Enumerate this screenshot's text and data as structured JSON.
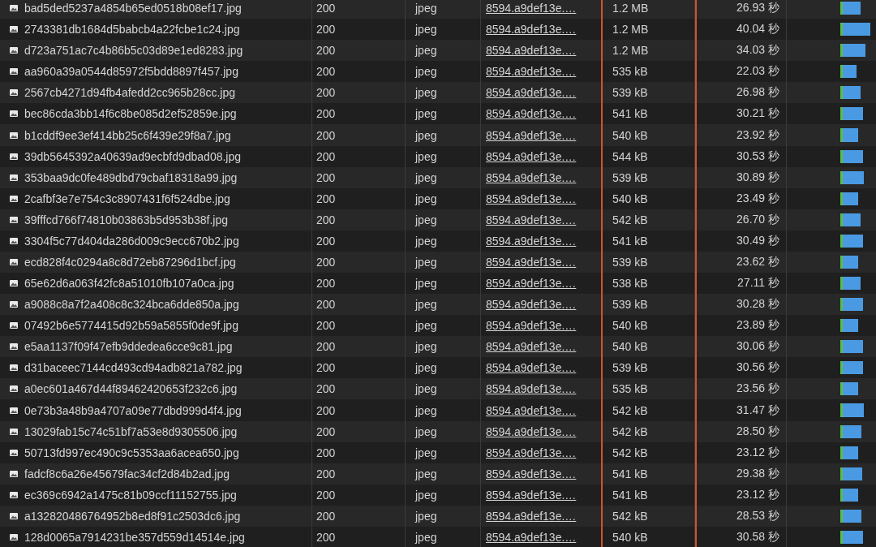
{
  "requests": [
    {
      "name": "bad5ded5237a4854b65ed0518b08ef17.jpg",
      "status": "200",
      "type": "jpeg",
      "initiator": "8594.a9def13e.…",
      "size": "1.2 MB",
      "time": "26.93 秒"
    },
    {
      "name": "2743381db1684d5babcb4a22fcbe1c24.jpg",
      "status": "200",
      "type": "jpeg",
      "initiator": "8594.a9def13e.…",
      "size": "1.2 MB",
      "time": "40.04 秒"
    },
    {
      "name": "d723a751ac7c4b86b5c03d89e1ed8283.jpg",
      "status": "200",
      "type": "jpeg",
      "initiator": "8594.a9def13e.…",
      "size": "1.2 MB",
      "time": "34.03 秒"
    },
    {
      "name": "aa960a39a0544d85972f5bdd8897f457.jpg",
      "status": "200",
      "type": "jpeg",
      "initiator": "8594.a9def13e.…",
      "size": "535 kB",
      "time": "22.03 秒"
    },
    {
      "name": "2567cb4271d94fb4afedd2cc965b28cc.jpg",
      "status": "200",
      "type": "jpeg",
      "initiator": "8594.a9def13e.…",
      "size": "539 kB",
      "time": "26.98 秒"
    },
    {
      "name": "bec86cda3bb14f6c8be085d2ef52859e.jpg",
      "status": "200",
      "type": "jpeg",
      "initiator": "8594.a9def13e.…",
      "size": "541 kB",
      "time": "30.21 秒"
    },
    {
      "name": "b1cddf9ee3ef414bb25c6f439e29f8a7.jpg",
      "status": "200",
      "type": "jpeg",
      "initiator": "8594.a9def13e.…",
      "size": "540 kB",
      "time": "23.92 秒"
    },
    {
      "name": "39db5645392a40639ad9ecbfd9dbad08.jpg",
      "status": "200",
      "type": "jpeg",
      "initiator": "8594.a9def13e.…",
      "size": "544 kB",
      "time": "30.53 秒"
    },
    {
      "name": "353baa9dc0fe489dbd79cbaf18318a99.jpg",
      "status": "200",
      "type": "jpeg",
      "initiator": "8594.a9def13e.…",
      "size": "539 kB",
      "time": "30.89 秒"
    },
    {
      "name": "2cafbf3e7e754c3c8907431f6f524dbe.jpg",
      "status": "200",
      "type": "jpeg",
      "initiator": "8594.a9def13e.…",
      "size": "540 kB",
      "time": "23.49 秒"
    },
    {
      "name": "39fffcd766f74810b03863b5d953b38f.jpg",
      "status": "200",
      "type": "jpeg",
      "initiator": "8594.a9def13e.…",
      "size": "542 kB",
      "time": "26.70 秒"
    },
    {
      "name": "3304f5c77d404da286d009c9ecc670b2.jpg",
      "status": "200",
      "type": "jpeg",
      "initiator": "8594.a9def13e.…",
      "size": "541 kB",
      "time": "30.49 秒"
    },
    {
      "name": "ecd828f4c0294a8c8d72eb87296d1bcf.jpg",
      "status": "200",
      "type": "jpeg",
      "initiator": "8594.a9def13e.…",
      "size": "539 kB",
      "time": "23.62 秒"
    },
    {
      "name": "65e62d6a063f42fc8a51010fb107a0ca.jpg",
      "status": "200",
      "type": "jpeg",
      "initiator": "8594.a9def13e.…",
      "size": "538 kB",
      "time": "27.11 秒"
    },
    {
      "name": "a9088c8a7f2a408c8c324bca6dde850a.jpg",
      "status": "200",
      "type": "jpeg",
      "initiator": "8594.a9def13e.…",
      "size": "539 kB",
      "time": "30.28 秒"
    },
    {
      "name": "07492b6e5774415d92b59a5855f0de9f.jpg",
      "status": "200",
      "type": "jpeg",
      "initiator": "8594.a9def13e.…",
      "size": "540 kB",
      "time": "23.89 秒"
    },
    {
      "name": "e5aa1137f09f47efb9ddedea6cce9c81.jpg",
      "status": "200",
      "type": "jpeg",
      "initiator": "8594.a9def13e.…",
      "size": "540 kB",
      "time": "30.06 秒"
    },
    {
      "name": "d31baceec7144cd493cd94adb821a782.jpg",
      "status": "200",
      "type": "jpeg",
      "initiator": "8594.a9def13e.…",
      "size": "539 kB",
      "time": "30.56 秒"
    },
    {
      "name": "a0ec601a467d44f89462420653f232c6.jpg",
      "status": "200",
      "type": "jpeg",
      "initiator": "8594.a9def13e.…",
      "size": "535 kB",
      "time": "23.56 秒"
    },
    {
      "name": "0e73b3a48b9a4707a09e77dbd999d4f4.jpg",
      "status": "200",
      "type": "jpeg",
      "initiator": "8594.a9def13e.…",
      "size": "542 kB",
      "time": "31.47 秒"
    },
    {
      "name": "13029fab15c74c51bf7a53e8d9305506.jpg",
      "status": "200",
      "type": "jpeg",
      "initiator": "8594.a9def13e.…",
      "size": "542 kB",
      "time": "28.50 秒"
    },
    {
      "name": "50713fd997ec490c9c5353aa6acea650.jpg",
      "status": "200",
      "type": "jpeg",
      "initiator": "8594.a9def13e.…",
      "size": "542 kB",
      "time": "23.12 秒"
    },
    {
      "name": "fadcf8c6a26e45679fac34cf2d84b2ad.jpg",
      "status": "200",
      "type": "jpeg",
      "initiator": "8594.a9def13e.…",
      "size": "541 kB",
      "time": "29.38 秒"
    },
    {
      "name": "ec369c6942a1475c81b09ccf11152755.jpg",
      "status": "200",
      "type": "jpeg",
      "initiator": "8594.a9def13e.…",
      "size": "541 kB",
      "time": "23.12 秒"
    },
    {
      "name": "a132820486764952b8ed8f91c2503dc6.jpg",
      "status": "200",
      "type": "jpeg",
      "initiator": "8594.a9def13e.…",
      "size": "542 kB",
      "time": "28.53 秒"
    },
    {
      "name": "128d0065a7914231be357d559d14514e.jpg",
      "status": "200",
      "type": "jpeg",
      "initiator": "8594.a9def13e.…",
      "size": "540 kB",
      "time": "30.58 秒"
    }
  ]
}
